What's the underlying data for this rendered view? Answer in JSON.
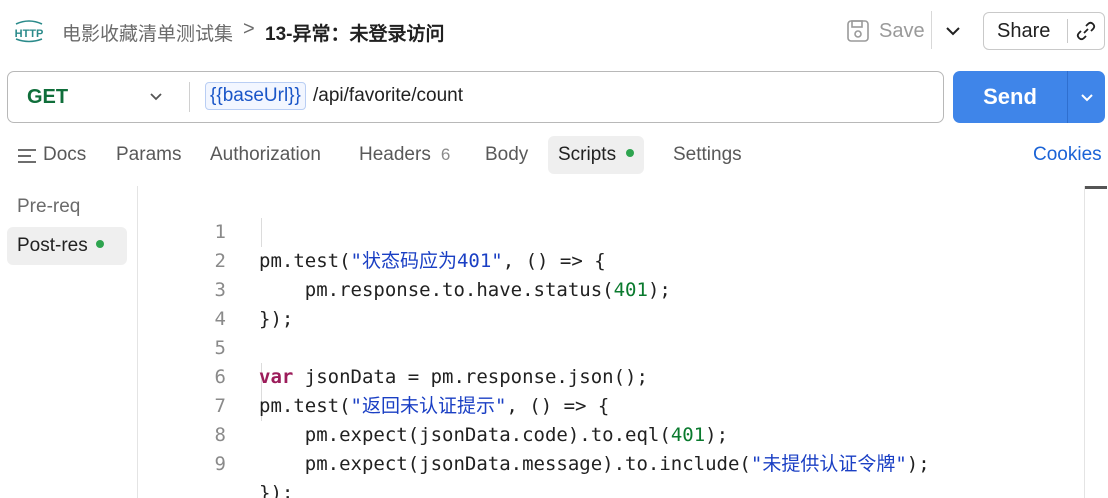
{
  "header": {
    "breadcrumb_parent": "电影收藏清单测试集",
    "breadcrumb_separator": ">",
    "title": "13-异常：未登录访问",
    "save_label": "Save",
    "share_label": "Share",
    "icons": {
      "protocol": "http-icon",
      "save": "save-icon",
      "caret": "chevron-down-icon",
      "link": "link-icon"
    }
  },
  "request": {
    "method": "GET",
    "url_variable": "{{baseUrl}}",
    "url_path": "/api/favorite/count",
    "send_label": "Send"
  },
  "tabs": [
    {
      "label": "Docs",
      "active": false
    },
    {
      "label": "Params",
      "active": false
    },
    {
      "label": "Authorization",
      "active": false
    },
    {
      "label": "Headers",
      "count": "6",
      "active": false
    },
    {
      "label": "Body",
      "active": false
    },
    {
      "label": "Scripts",
      "active": true,
      "indicator": "green-dot"
    },
    {
      "label": "Settings",
      "active": false
    }
  ],
  "cookies_label": "Cookies",
  "scripts_sidebar": [
    {
      "label": "Pre-req",
      "active": false
    },
    {
      "label": "Post-res",
      "active": true,
      "indicator": "green-dot"
    }
  ],
  "editor": {
    "line_numbers": [
      "1",
      "2",
      "3",
      "4",
      "5",
      "6",
      "7",
      "8",
      "9"
    ],
    "lines": [
      "pm.test(\"状态码应为401\", () => {",
      "    pm.response.to.have.status(401);",
      "});",
      "",
      "var jsonData = pm.response.json();",
      "pm.test(\"返回未认证提示\", () => {",
      "    pm.expect(jsonData.code).to.eql(401);",
      "    pm.expect(jsonData.message).to.include(\"未提供认证令牌\");",
      "});"
    ]
  },
  "colors": {
    "accent": "#3f85e9",
    "method_get": "#0f6e3a",
    "link": "#1a63d6",
    "status_dot": "#2ea44f",
    "string": "#1a3fc4",
    "keyword": "#9c1c5a",
    "number": "#0a7a2e"
  }
}
